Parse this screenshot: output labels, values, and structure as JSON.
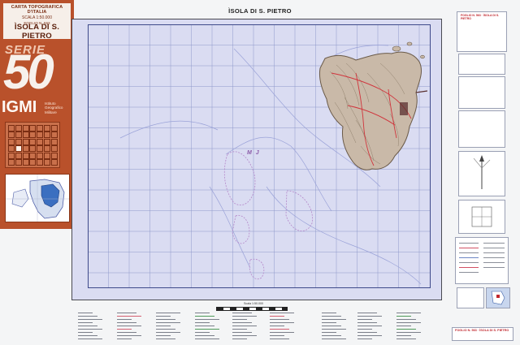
{
  "cover": {
    "header_line1": "CARTA TOPOGRAFICA D'ITALIA",
    "header_line2": "SCALA 1:50.000",
    "header_line3": "FOGLIO N. 563",
    "title": "ÌSOLA DI S. PIETRO",
    "serie_label": "SERIE",
    "serie_number": "50",
    "publisher": "IGMI",
    "publisher_full": [
      "Istituto",
      "Geografico",
      "Militare"
    ]
  },
  "map": {
    "title": "ÌSOLA DI S. PIETRO",
    "sea_label": "M J",
    "colors": {
      "sea": "#dadcf2",
      "grid": "#8e98c9",
      "land": "#c9b9a8",
      "relief": "#7a6a5a",
      "roads": "#d0343c",
      "cover": "#b9512b",
      "magenta": "#c45fb6"
    }
  },
  "legend": {
    "title": "FOGLIO N. 563 · ÌSOLA DI S. PIETRO"
  },
  "footer": {
    "sheet_id": "FOGLIO N. 563 · ÌSOLA DI S. PIETRO",
    "scale": "Scala 1:50.000"
  }
}
